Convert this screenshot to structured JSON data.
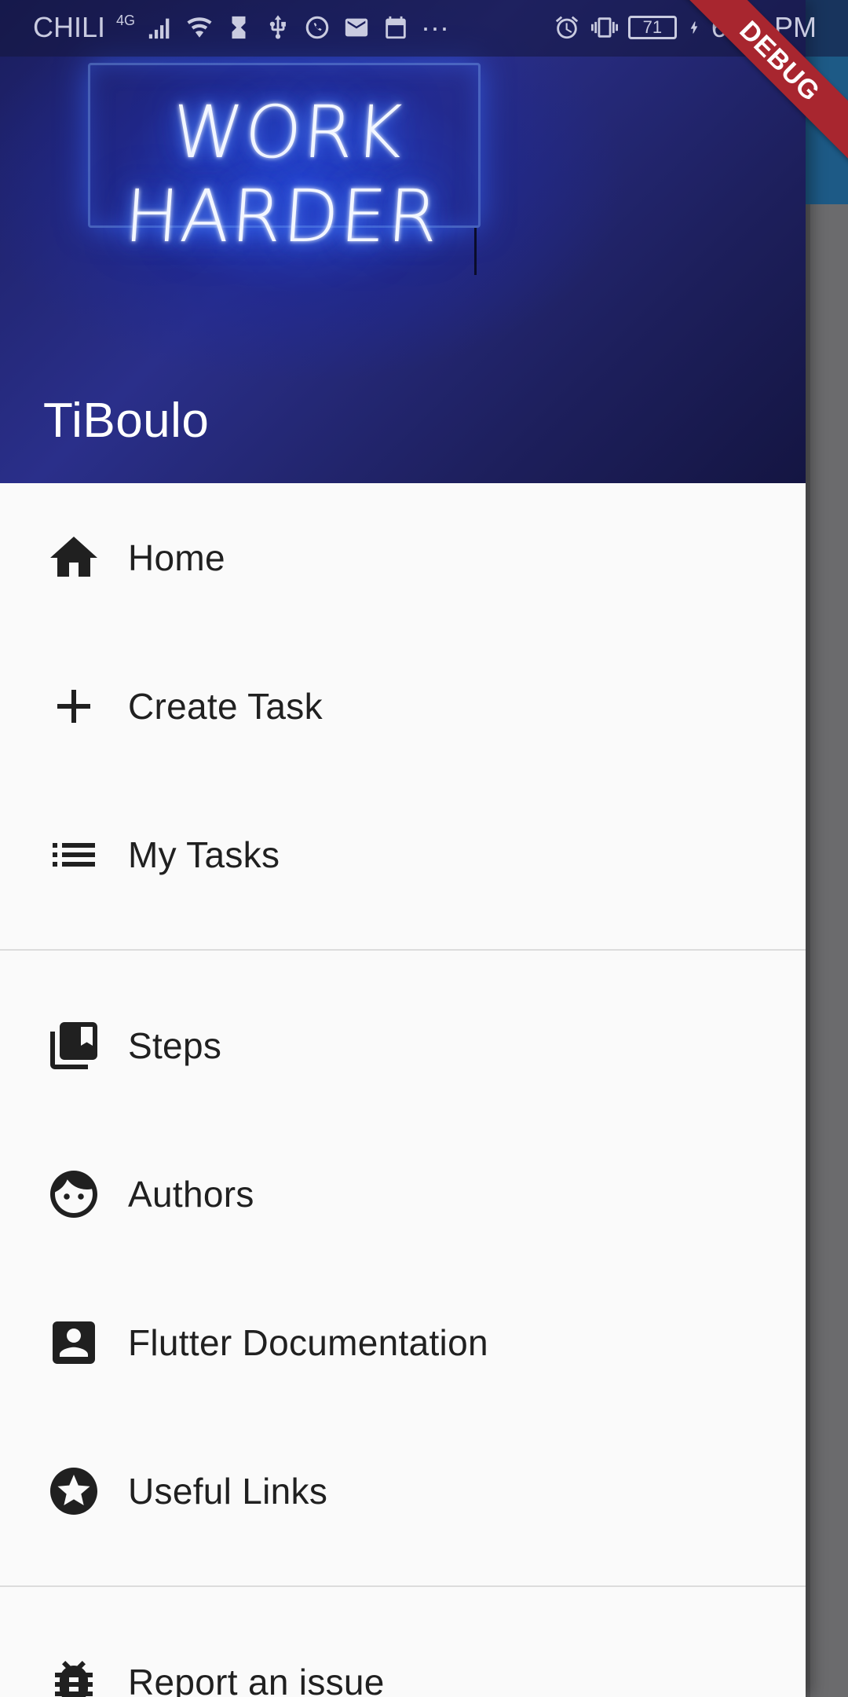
{
  "status_bar": {
    "carrier": "CHILI",
    "network": "4G",
    "battery": "71",
    "time": "6:03 PM",
    "more": "···"
  },
  "debug_banner": "DEBUG",
  "drawer": {
    "header_image_text": "WORK HARDER",
    "title": "TiBoulo",
    "items": [
      {
        "label": "Home",
        "icon": "home-icon"
      },
      {
        "label": "Create Task",
        "icon": "add-icon"
      },
      {
        "label": "My Tasks",
        "icon": "list-icon"
      },
      {
        "label": "Steps",
        "icon": "library-books-icon"
      },
      {
        "label": "Authors",
        "icon": "face-icon"
      },
      {
        "label": "Flutter Documentation",
        "icon": "account-box-icon"
      },
      {
        "label": "Useful Links",
        "icon": "stars-icon"
      },
      {
        "label": "Report an issue",
        "icon": "bug-report-icon"
      }
    ]
  },
  "colors": {
    "header_bg": "#1a1d5e",
    "drawer_bg": "#fafafa",
    "text_dark": "#202020",
    "debug_red": "#a8262f"
  }
}
